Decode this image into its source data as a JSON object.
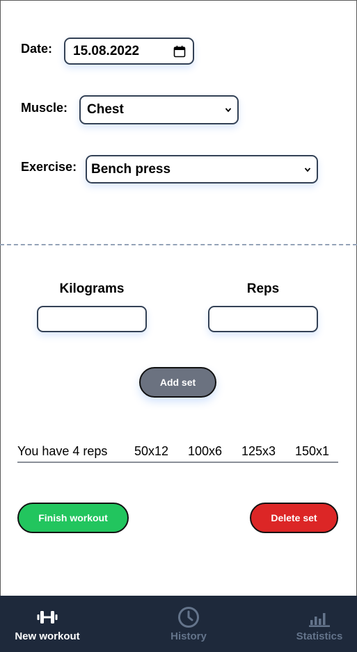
{
  "form": {
    "date_label": "Date:",
    "date_value": "15.08.2022",
    "muscle_label": "Muscle:",
    "muscle_value": "Chest",
    "exercise_label": "Exercise:",
    "exercise_value": "Bench press"
  },
  "sets": {
    "kg_label": "Kilograms",
    "kg_value": "",
    "reps_label": "Reps",
    "reps_value": "",
    "add_label": "Add set"
  },
  "summary": {
    "text": "You have 4 reps",
    "items": [
      "50x12",
      "100x6",
      "125x3",
      "150x1"
    ]
  },
  "actions": {
    "finish_label": "Finish workout",
    "delete_label": "Delete set"
  },
  "nav": {
    "items": [
      {
        "label": "New workout",
        "icon": "dumbbell-icon",
        "active": true
      },
      {
        "label": "History",
        "icon": "clock-icon",
        "active": false
      },
      {
        "label": "Statistics",
        "icon": "bar-chart-icon",
        "active": false
      }
    ]
  },
  "colors": {
    "nav_bg": "#1e293b",
    "field_border": "#334155",
    "add_button": "#6b7280",
    "finish_button": "#22c55e",
    "delete_button": "#dc2626",
    "nav_active": "#ffffff",
    "nav_inactive": "#64748b"
  }
}
